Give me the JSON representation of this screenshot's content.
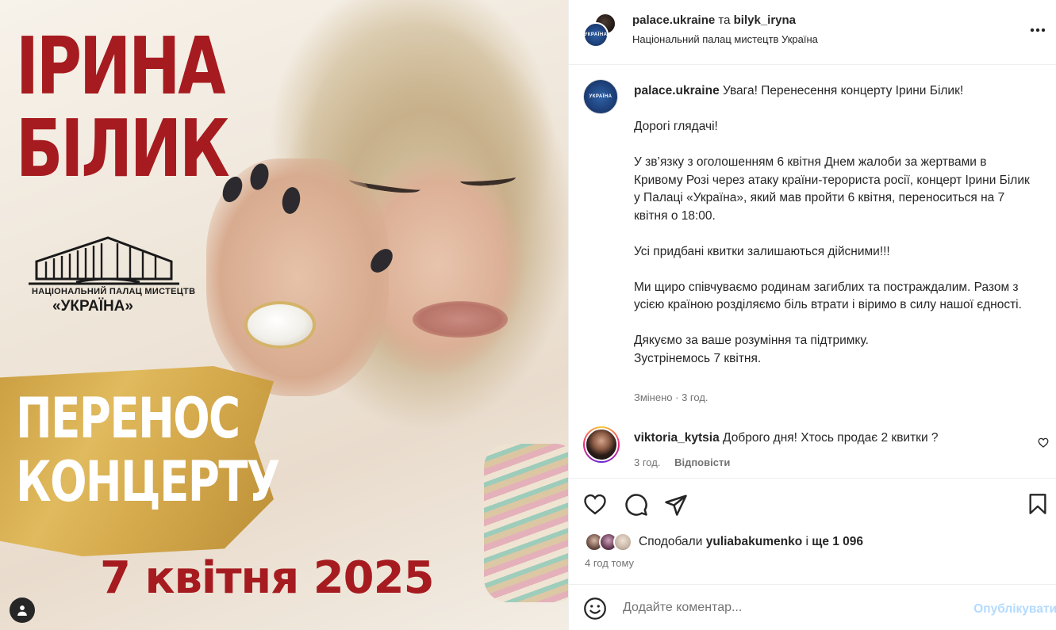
{
  "poster": {
    "title_line1": "ІРИНА",
    "title_line2": "БІЛИК",
    "palace_line1": "НАЦІОНАЛЬНИЙ ПАЛАЦ МИСТЕЦТВ",
    "palace_line2": "«УКРАЇНА»",
    "reschedule_line1": "ПЕРЕНОС",
    "reschedule_line2": "КОНЦЕРТУ",
    "date": "7 квітня 2025",
    "user_tag_icon": "user-icon"
  },
  "header": {
    "account1": "palace.ukraine",
    "separator": "та",
    "account2": "bilyk_iryna",
    "subtitle": "Національний палац мистецтв Україна",
    "more_icon": "more-horizontal-icon"
  },
  "caption": {
    "username": "palace.ukraine",
    "headline": "Увага! Перенесення концерту Ірини Білик!",
    "para1": "Дорогі глядачі!",
    "para2": "У зв’язку з оголошенням 6 квітня Днем жалоби за жертвами в Кривому Розі через атаку країни-терориста росії, концерт Ірини Білик у Палаці «Україна», який мав пройти 6 квітня, переноситься на 7 квітня о 18:00.",
    "para3": "Усі придбані квитки залишаються дійсними!!!",
    "para4": "Ми щиро співчуваємо родинам загиблих та постраждалим. Разом з усією країною розділяємо біль втрати і віримо в силу нашої єдності.",
    "para5_line1": "Дякуємо за ваше розуміння та підтримку.",
    "para5_line2": "Зустрінемось 7 квітня.",
    "edited": "Змінено",
    "dot": "·",
    "time": "3 год."
  },
  "comment": {
    "username": "viktoria_kytsia",
    "text": "Доброго дня! Хтось продає 2 квитки ?",
    "time": "3 год.",
    "reply": "Відповісти",
    "like_icon": "heart-outline-icon"
  },
  "actions": {
    "like_icon": "heart-outline-icon",
    "comment_icon": "comment-bubble-icon",
    "share_icon": "paper-plane-icon",
    "save_icon": "bookmark-icon"
  },
  "likes": {
    "prefix": "Сподобали",
    "user": "yuliabakumenko",
    "and": "і",
    "rest": "ще 1 096"
  },
  "time_ago": "4 год тому",
  "add_comment": {
    "emoji_icon": "emoji-smile-icon",
    "placeholder": "Додайте коментар...",
    "publish": "Опублікувати"
  },
  "colors": {
    "poster_red": "#a61b1f",
    "publish_disabled": "#b3dbff",
    "secondary_text": "#737373"
  }
}
